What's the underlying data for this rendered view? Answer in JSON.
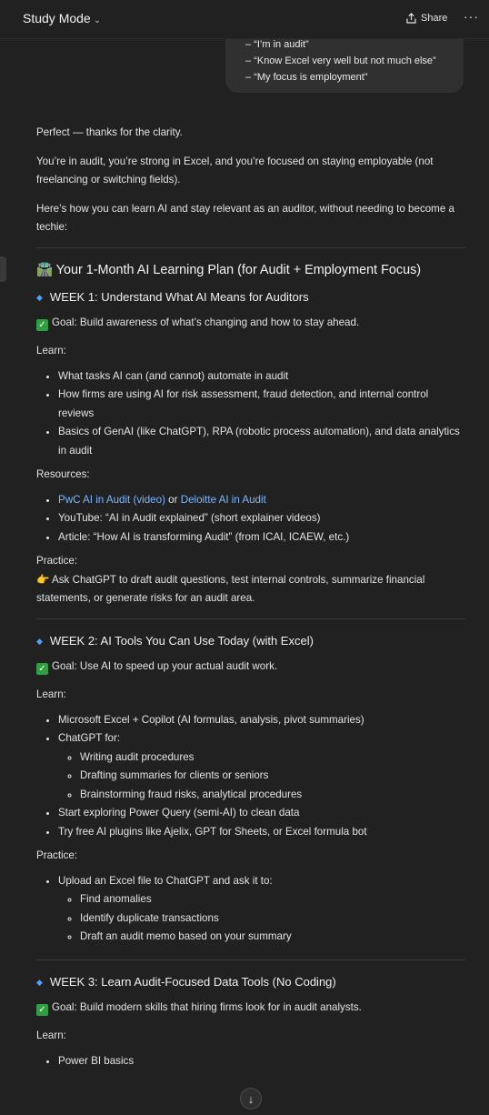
{
  "header": {
    "title": "Study Mode",
    "share_label": "Share",
    "more_label": "···"
  },
  "user_bubble": {
    "lines": [
      "“I’m in audit”",
      "“Know Excel very well but not much else”",
      "“My focus is employment”"
    ]
  },
  "intro": [
    "Perfect — thanks for the clarity.",
    "You’re in audit, you’re strong in Excel, and you’re focused on staying employable (not freelancing or switching fields).",
    "Here’s how you can learn AI and stay relevant as an auditor, without needing to become a techie:"
  ],
  "plan": {
    "emoji": "🛣️",
    "title": "Your 1-Month AI Learning Plan (for Audit + Employment Focus)"
  },
  "week1": {
    "title": "WEEK 1: Understand What AI Means for Auditors",
    "goal": "Goal: Build awareness of what’s changing and how to stay ahead.",
    "learn_label": "Learn:",
    "learn": [
      "What tasks AI can (and cannot) automate in audit",
      "How firms are using AI for risk assessment, fraud detection, and internal control reviews",
      "Basics of GenAI (like ChatGPT), RPA (robotic process automation), and data analytics in audit"
    ],
    "resources_label": "Resources:",
    "resource_link1": "PwC AI in Audit (video)",
    "resource_or": " or ",
    "resource_link2": "Deloitte AI in Audit",
    "resource2": "YouTube: “AI in Audit explained” (short explainer videos)",
    "resource3": "Article: “How AI is transforming Audit” (from ICAI, ICAEW, etc.)",
    "practice_label": "Practice:",
    "practice_emoji": "👉",
    "practice": "Ask ChatGPT to draft audit questions, test internal controls, summarize financial statements, or generate risks for an audit area."
  },
  "week2": {
    "title": "WEEK 2: AI Tools You Can Use Today (with Excel)",
    "goal": "Goal: Use AI to speed up your actual audit work.",
    "learn_label": "Learn:",
    "excel": "Microsoft Excel + Copilot (AI formulas, analysis, pivot summaries)",
    "chatgpt_for": "ChatGPT for:",
    "chatgpt_items": [
      "Writing audit procedures",
      "Drafting summaries for clients or seniors",
      "Brainstorming fraud risks, analytical procedures"
    ],
    "power_query": "Start exploring Power Query (semi-AI) to clean data",
    "plugins": "Try free AI plugins like Ajelix, GPT for Sheets, or Excel formula bot",
    "practice_label": "Practice:",
    "upload": "Upload an Excel file to ChatGPT and ask it to:",
    "upload_items": [
      "Find anomalies",
      "Identify duplicate transactions",
      "Draft an audit memo based on your summary"
    ]
  },
  "week3": {
    "title": "WEEK 3: Learn Audit-Focused Data Tools (No Coding)",
    "goal": "Goal: Build modern skills that hiring firms look for in audit analysts.",
    "learn_label": "Learn:",
    "learn_first": "Power BI basics"
  },
  "icons": {
    "check": "✓",
    "diamond": "◆",
    "share": "share-icon",
    "scroll": "↓"
  }
}
